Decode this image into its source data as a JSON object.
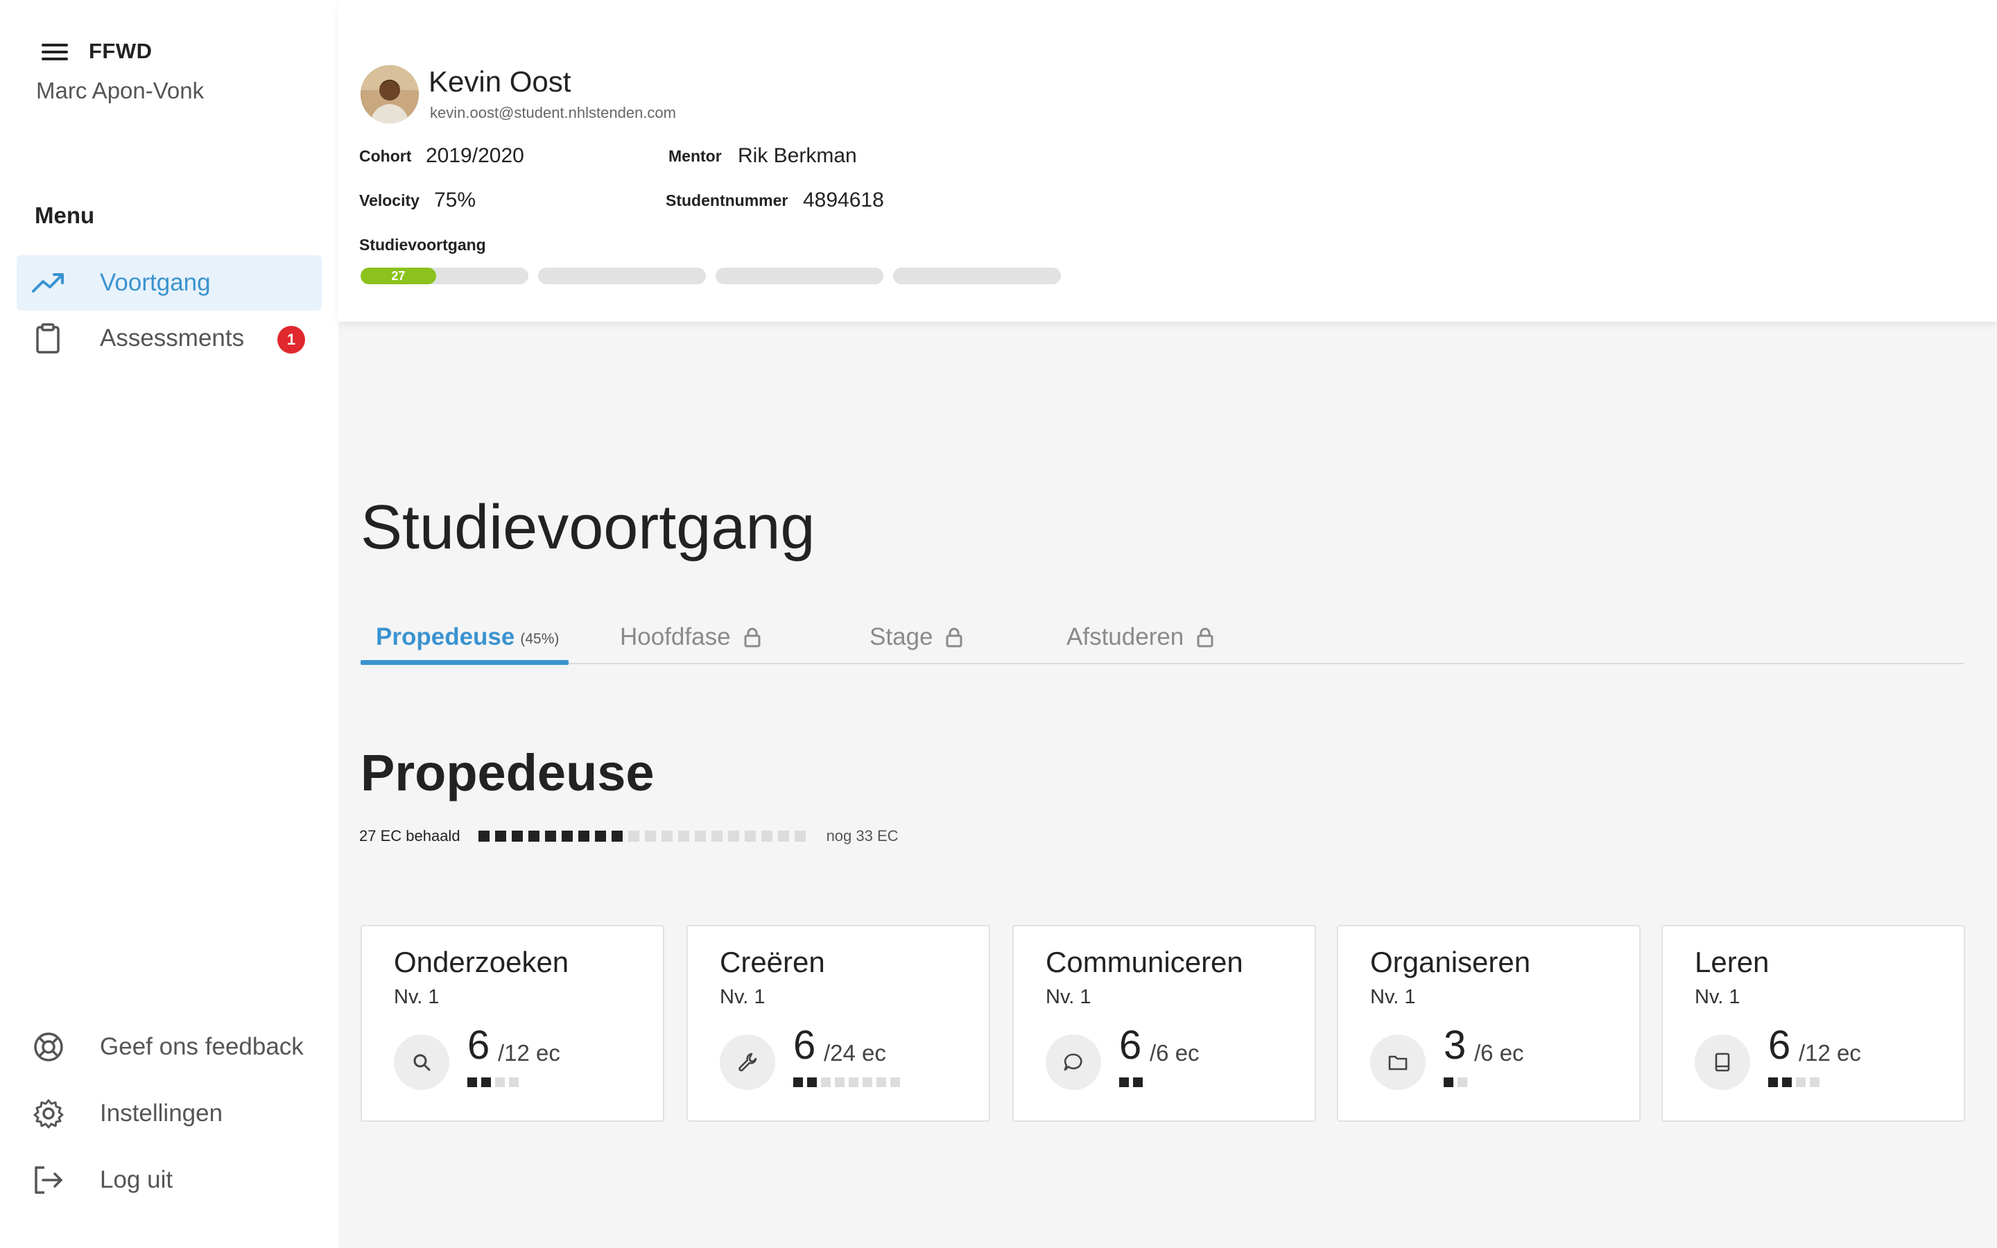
{
  "sidebar": {
    "brand": "FFWD",
    "user_name": "Marc Apon-Vonk",
    "menu_title": "Menu",
    "nav": [
      {
        "label": "Voortgang",
        "icon": "trending-up-icon",
        "active": true
      },
      {
        "label": "Assessments",
        "icon": "clipboard-icon",
        "badge": "1"
      }
    ],
    "footer": [
      {
        "label": "Geef ons feedback",
        "icon": "lifebuoy-icon"
      },
      {
        "label": "Instellingen",
        "icon": "gear-icon"
      },
      {
        "label": "Log uit",
        "icon": "logout-icon"
      }
    ]
  },
  "student": {
    "name": "Kevin Oost",
    "email": "kevin.oost@student.nhlstenden.com",
    "cohort_label": "Cohort",
    "cohort": "2019/2020",
    "mentor_label": "Mentor",
    "mentor": "Rik Berkman",
    "velocity_label": "Velocity",
    "velocity": "75%",
    "studentnummer_label": "Studentnummer",
    "studentnummer": "4894618",
    "progress_label": "Studievoortgang",
    "progress_value": "27",
    "progress_fraction": 0.45
  },
  "main": {
    "title": "Studievoortgang",
    "tabs": [
      {
        "label": "Propedeuse",
        "pct": "(45%)",
        "active": true
      },
      {
        "label": "Hoofdfase",
        "locked": true
      },
      {
        "label": "Stage",
        "locked": true
      },
      {
        "label": "Afstuderen",
        "locked": true
      }
    ],
    "section_title": "Propedeuse",
    "ec_achieved_label": "27 EC behaald",
    "ec_remaining_label": "nog 33 EC",
    "ec_achieved": 27,
    "ec_total": 60,
    "cards": [
      {
        "title": "Onderzoeken",
        "level": "Nv. 1",
        "score": "6",
        "max": "/12 ec",
        "icon": "search-icon",
        "filled": 2,
        "total": 4
      },
      {
        "title": "Creëren",
        "level": "Nv. 1",
        "score": "6",
        "max": "/24 ec",
        "icon": "wrench-icon",
        "filled": 2,
        "total": 8
      },
      {
        "title": "Communiceren",
        "level": "Nv. 1",
        "score": "6",
        "max": "/6 ec",
        "icon": "chat-bubble-icon",
        "filled": 2,
        "total": 2
      },
      {
        "title": "Organiseren",
        "level": "Nv. 1",
        "score": "3",
        "max": "/6 ec",
        "icon": "folder-icon",
        "filled": 1,
        "total": 2
      },
      {
        "title": "Leren",
        "level": "Nv. 1",
        "score": "6",
        "max": "/12 ec",
        "icon": "book-icon",
        "filled": 2,
        "total": 4
      }
    ]
  },
  "colors": {
    "accent": "#3a93d0",
    "progress_green": "#8bc21c",
    "badge_red": "#e0282e"
  }
}
